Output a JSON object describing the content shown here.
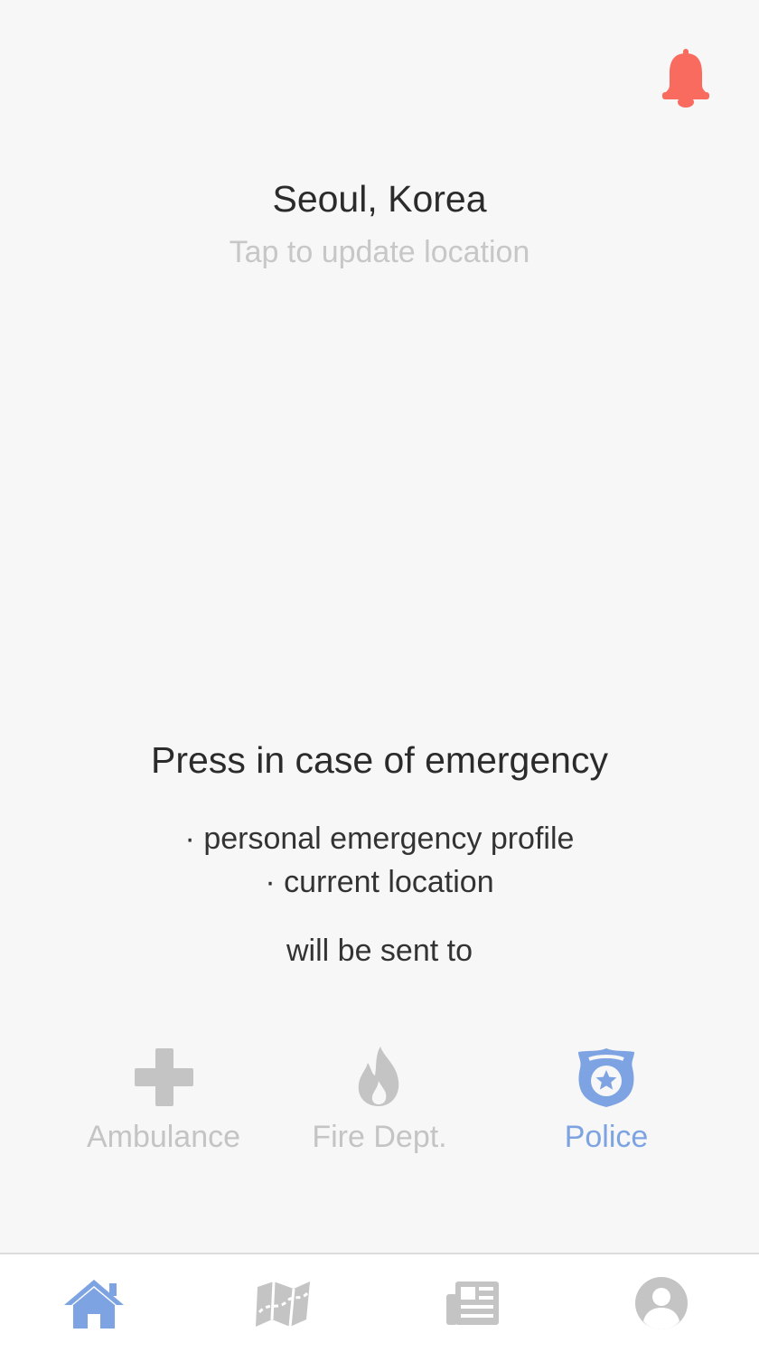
{
  "header": {
    "notification_icon": "bell-icon",
    "notification_color": "#f96b5f"
  },
  "location": {
    "city": "Seoul, Korea",
    "hint": "Tap to update location"
  },
  "emergency": {
    "title": "Press in case of emergency",
    "items": [
      "· personal emergency profile",
      "· current location"
    ],
    "sent_to": "will be sent to"
  },
  "services": [
    {
      "label": "Ambulance",
      "icon": "medical-cross-icon",
      "selected": false
    },
    {
      "label": "Fire Dept.",
      "icon": "flame-icon",
      "selected": false
    },
    {
      "label": "Police",
      "icon": "police-badge-icon",
      "selected": true
    }
  ],
  "tabs": [
    {
      "name": "home",
      "icon": "home-icon",
      "active": true
    },
    {
      "name": "map",
      "icon": "map-icon",
      "active": false
    },
    {
      "name": "news",
      "icon": "newspaper-icon",
      "active": false
    },
    {
      "name": "profile",
      "icon": "user-icon",
      "active": false
    }
  ],
  "colors": {
    "accent": "#7ea3e2",
    "inactive": "#c4c4c4",
    "alert": "#f96b5f",
    "background": "#f7f7f7"
  }
}
